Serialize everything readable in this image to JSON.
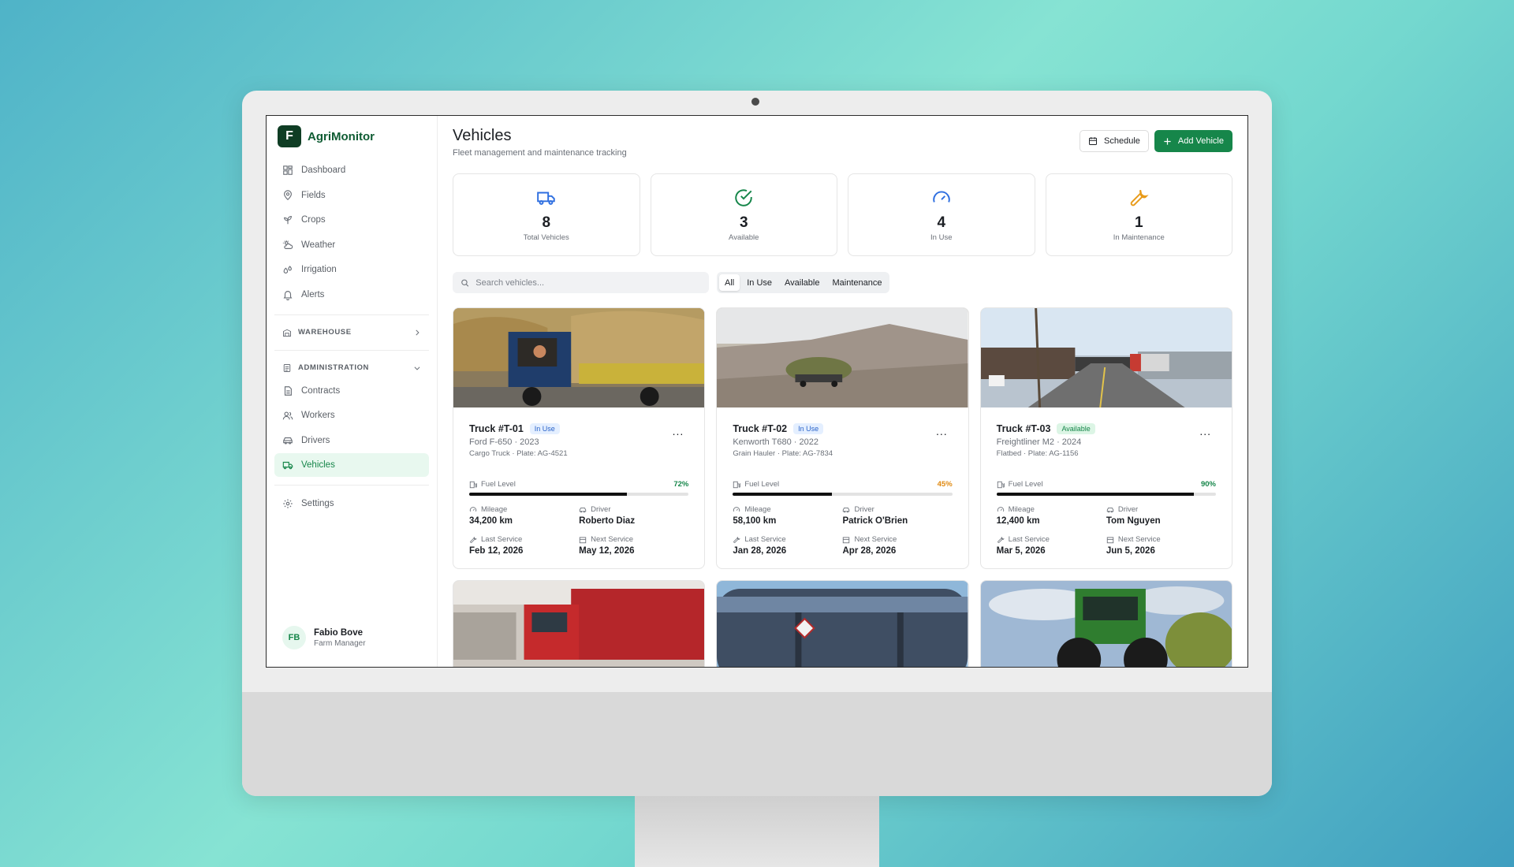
{
  "app": {
    "name": "AgriMonitor",
    "logo_letter": "F"
  },
  "nav": {
    "items": [
      {
        "label": "Dashboard",
        "icon": "dashboard-icon"
      },
      {
        "label": "Fields",
        "icon": "map-pin-icon"
      },
      {
        "label": "Crops",
        "icon": "sprout-icon"
      },
      {
        "label": "Weather",
        "icon": "cloud-sun-icon"
      },
      {
        "label": "Irrigation",
        "icon": "droplets-icon"
      },
      {
        "label": "Alerts",
        "icon": "bell-icon"
      }
    ],
    "warehouse_label": "WAREHOUSE",
    "administration_label": "ADMINISTRATION",
    "admin_items": [
      {
        "label": "Contracts",
        "icon": "file-text-icon"
      },
      {
        "label": "Workers",
        "icon": "users-icon"
      },
      {
        "label": "Drivers",
        "icon": "car-icon"
      },
      {
        "label": "Vehicles",
        "icon": "truck-icon",
        "active": true
      }
    ],
    "settings_label": "Settings"
  },
  "user": {
    "initials": "FB",
    "name": "Fabio Bove",
    "role": "Farm Manager"
  },
  "page": {
    "title": "Vehicles",
    "subtitle": "Fleet management and maintenance tracking",
    "schedule_label": "Schedule",
    "add_label": "Add Vehicle"
  },
  "stats": [
    {
      "value": "8",
      "label": "Total Vehicles",
      "icon": "truck-icon",
      "color": "#2f6fe0"
    },
    {
      "value": "3",
      "label": "Available",
      "icon": "check-circle-icon",
      "color": "#16864a"
    },
    {
      "value": "4",
      "label": "In Use",
      "icon": "gauge-icon",
      "color": "#2f6fe0"
    },
    {
      "value": "1",
      "label": "In Maintenance",
      "icon": "wrench-icon",
      "color": "#e89b1a"
    }
  ],
  "search": {
    "placeholder": "Search vehicles..."
  },
  "filters": [
    "All",
    "In Use",
    "Available",
    "Maintenance"
  ],
  "active_filter": "All",
  "labels": {
    "fuel": "Fuel Level",
    "mileage": "Mileage",
    "driver": "Driver",
    "last_service": "Last Service",
    "next_service": "Next Service",
    "more": "..."
  },
  "vehicles": [
    {
      "name": "Truck #T-01",
      "status": "In Use",
      "model": "Ford F-650 · 2023",
      "meta": "Cargo Truck · Plate: AG-4521",
      "fuel": "72%",
      "fuel_fraction": 0.72,
      "fuel_color": "#16864a",
      "mileage": "34,200 km",
      "driver": "Roberto Diaz",
      "last_service": "Feb 12, 2026",
      "next_service": "May 12, 2026"
    },
    {
      "name": "Truck #T-02",
      "status": "In Use",
      "model": "Kenworth T680 · 2022",
      "meta": "Grain Hauler · Plate: AG-7834",
      "fuel": "45%",
      "fuel_fraction": 0.45,
      "fuel_color": "#e08a12",
      "mileage": "58,100 km",
      "driver": "Patrick O'Brien",
      "last_service": "Jan 28, 2026",
      "next_service": "Apr 28, 2026"
    },
    {
      "name": "Truck #T-03",
      "status": "Available",
      "model": "Freightliner M2 · 2024",
      "meta": "Flatbed · Plate: AG-1156",
      "fuel": "90%",
      "fuel_fraction": 0.9,
      "fuel_color": "#16864a",
      "mileage": "12,400 km",
      "driver": "Tom Nguyen",
      "last_service": "Mar 5, 2026",
      "next_service": "Jun 5, 2026"
    }
  ]
}
